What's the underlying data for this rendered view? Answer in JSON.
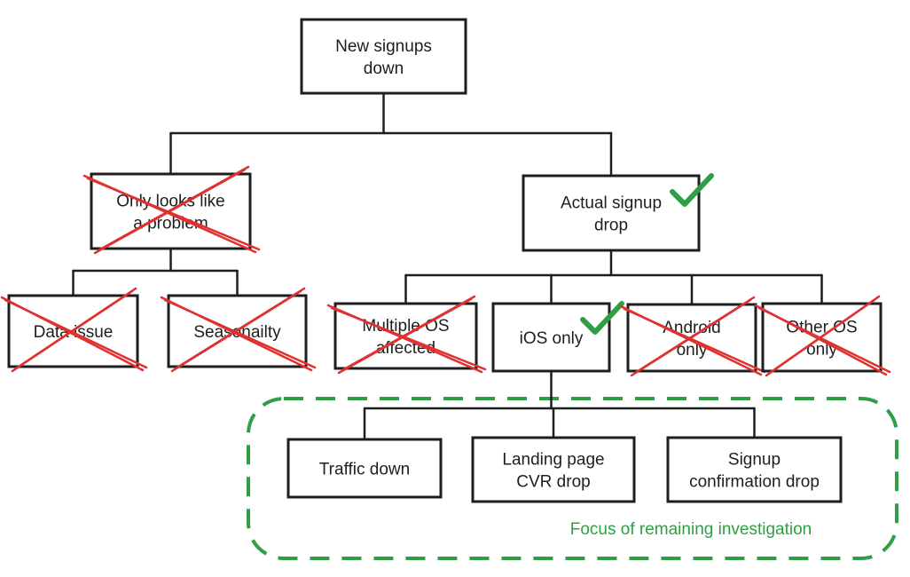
{
  "colors": {
    "stroke": "#1e1e1e",
    "rejected": "#e03131",
    "confirmed": "#2f9e44"
  },
  "nodes": [
    {
      "id": "root",
      "lines": [
        "New signups",
        "down"
      ],
      "status": "none"
    },
    {
      "id": "only-looks",
      "lines": [
        "Only looks like",
        "a problem"
      ],
      "status": "rejected"
    },
    {
      "id": "actual-drop",
      "lines": [
        "Actual signup",
        "drop"
      ],
      "status": "confirmed"
    },
    {
      "id": "data-issue",
      "lines": [
        "Data issue"
      ],
      "status": "rejected"
    },
    {
      "id": "seasonality",
      "lines": [
        "Seasonailty"
      ],
      "status": "rejected"
    },
    {
      "id": "multiple-os",
      "lines": [
        "Multiple OS",
        "affected"
      ],
      "status": "rejected"
    },
    {
      "id": "ios-only",
      "lines": [
        "iOS only"
      ],
      "status": "confirmed"
    },
    {
      "id": "android-only",
      "lines": [
        "Android",
        "only"
      ],
      "status": "rejected"
    },
    {
      "id": "other-os",
      "lines": [
        "Other OS",
        "only"
      ],
      "status": "rejected"
    },
    {
      "id": "traffic-down",
      "lines": [
        "Traffic down"
      ],
      "status": "none"
    },
    {
      "id": "landing-cvr",
      "lines": [
        "Landing page",
        "CVR drop"
      ],
      "status": "none"
    },
    {
      "id": "signup-confirmation",
      "lines": [
        "Signup",
        "confirmation drop"
      ],
      "status": "none"
    }
  ],
  "edges": [
    [
      "root",
      "only-looks"
    ],
    [
      "root",
      "actual-drop"
    ],
    [
      "only-looks",
      "data-issue"
    ],
    [
      "only-looks",
      "seasonality"
    ],
    [
      "actual-drop",
      "multiple-os"
    ],
    [
      "actual-drop",
      "ios-only"
    ],
    [
      "actual-drop",
      "android-only"
    ],
    [
      "actual-drop",
      "other-os"
    ],
    [
      "ios-only",
      "traffic-down"
    ],
    [
      "ios-only",
      "landing-cvr"
    ],
    [
      "ios-only",
      "signup-confirmation"
    ]
  ],
  "group": {
    "label": "Focus of remaining investigation"
  }
}
